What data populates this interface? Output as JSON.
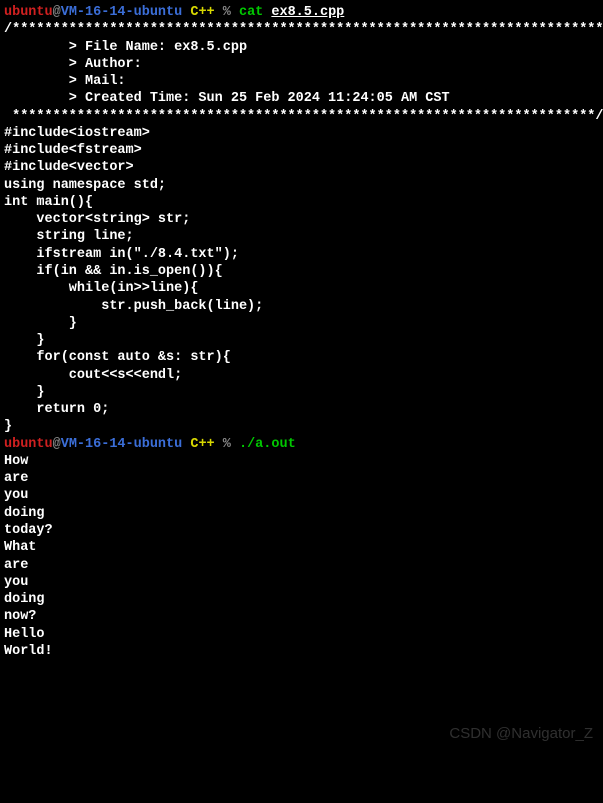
{
  "prompt1": {
    "user": "ubuntu",
    "at": "@",
    "host": "VM-16-14-ubuntu",
    "dir": " C++",
    "pct": " % ",
    "cmd": "cat ",
    "file": "ex8.5.cpp"
  },
  "source": {
    "l0": "/*************************************************************************",
    "l1": "        > File Name: ex8.5.cpp",
    "l2": "        > Author:",
    "l3": "        > Mail:",
    "l4": "        > Created Time: Sun 25 Feb 2024 11:24:05 AM CST",
    "l5": " ************************************************************************/",
    "l6": "",
    "l7": "#include<iostream>",
    "l8": "#include<fstream>",
    "l9": "#include<vector>",
    "l10": "using namespace std;",
    "l11": "",
    "l12": "int main(){",
    "l13": "    vector<string> str;",
    "l14": "    string line;",
    "l15": "    ifstream in(\"./8.4.txt\");",
    "l16": "    if(in && in.is_open()){",
    "l17": "        while(in>>line){",
    "l18": "            str.push_back(line);",
    "l19": "        }",
    "l20": "    }",
    "l21": "",
    "l22": "    for(const auto &s: str){",
    "l23": "        cout<<s<<endl;",
    "l24": "    }",
    "l25": "",
    "l26": "    return 0;",
    "l27": "}"
  },
  "prompt2": {
    "user": "ubuntu",
    "at": "@",
    "host": "VM-16-14-ubuntu",
    "dir": " C++",
    "pct": " % ",
    "cmd": "./a.out"
  },
  "output": {
    "l0": "How",
    "l1": "are",
    "l2": "you",
    "l3": "doing",
    "l4": "today?",
    "l5": "What",
    "l6": "are",
    "l7": "you",
    "l8": "doing",
    "l9": "now?",
    "l10": "Hello",
    "l11": "World!"
  },
  "watermark": "CSDN @Navigator_Z"
}
